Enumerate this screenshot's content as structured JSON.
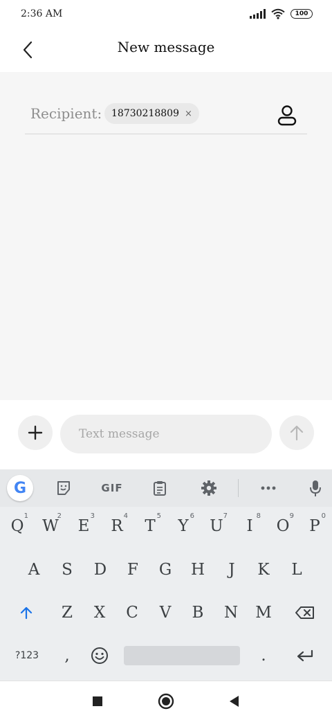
{
  "status_bar": {
    "time": "2:36 AM",
    "battery": "100"
  },
  "header": {
    "title": "New message"
  },
  "recipient": {
    "label": "Recipient:",
    "chip_value": "18730218809",
    "chip_remove": "×"
  },
  "compose": {
    "placeholder": "Text message"
  },
  "keyboard": {
    "toolbar": {
      "gif_label": "GIF"
    },
    "row1": [
      {
        "key": "Q",
        "hint": "1"
      },
      {
        "key": "W",
        "hint": "2"
      },
      {
        "key": "E",
        "hint": "3"
      },
      {
        "key": "R",
        "hint": "4"
      },
      {
        "key": "T",
        "hint": "5"
      },
      {
        "key": "Y",
        "hint": "6"
      },
      {
        "key": "U",
        "hint": "7"
      },
      {
        "key": "I",
        "hint": "8"
      },
      {
        "key": "O",
        "hint": "9"
      },
      {
        "key": "P",
        "hint": "0"
      }
    ],
    "row2": [
      "A",
      "S",
      "D",
      "F",
      "G",
      "H",
      "J",
      "K",
      "L"
    ],
    "row3": [
      "Z",
      "X",
      "C",
      "V",
      "B",
      "N",
      "M"
    ],
    "row4": {
      "symbols": "?123",
      "comma": ",",
      "period": "."
    }
  },
  "colors": {
    "shift_accent": "#1a73e8",
    "google_blue": "#4285f4"
  },
  "icons": [
    "back-icon",
    "contact-icon",
    "plus-icon",
    "send-arrow-icon",
    "google-icon",
    "sticker-icon",
    "clipboard-icon",
    "gear-icon",
    "more-icon",
    "mic-icon",
    "shift-icon",
    "backspace-icon",
    "emoji-icon",
    "enter-icon",
    "recents-icon",
    "home-icon",
    "back-triangle-icon"
  ]
}
